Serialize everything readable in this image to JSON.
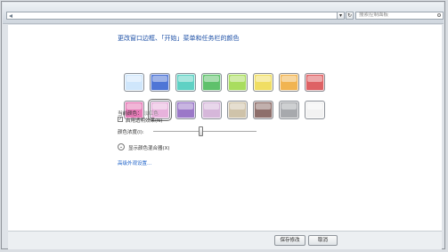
{
  "window": {
    "search": {
      "placeholder": "搜索控制面板"
    }
  },
  "toolbar": {
    "dropdown_icon": "chevron-down-icon",
    "refresh_icon": "refresh-icon"
  },
  "main": {
    "title": "更改窗口边框、「开始」菜单和任务栏的颜色",
    "swatches": [
      {
        "name": "sky",
        "color": "#cfe6fb"
      },
      {
        "name": "twilight",
        "color": "#4f76d6"
      },
      {
        "name": "sea",
        "color": "#5fd1c4"
      },
      {
        "name": "leaf",
        "color": "#5fc16c"
      },
      {
        "name": "lime",
        "color": "#a9dd5f"
      },
      {
        "name": "lemon",
        "color": "#f0de63"
      },
      {
        "name": "pumpkin",
        "color": "#f1b451"
      },
      {
        "name": "ruby",
        "color": "#de6265"
      },
      {
        "name": "fuchsia",
        "color": "#e67ab7"
      },
      {
        "name": "blush",
        "color": "#e7b2dc"
      },
      {
        "name": "violet",
        "color": "#9b78c8"
      },
      {
        "name": "lavender",
        "color": "#d6b7da"
      },
      {
        "name": "taupe",
        "color": "#cfc3aa"
      },
      {
        "name": "chocolate",
        "color": "#8e6f6b"
      },
      {
        "name": "slate",
        "color": "#a7a9ad"
      },
      {
        "name": "frost",
        "color": "#f2f2f2"
      }
    ],
    "selected_swatch_index": 9,
    "current_color_label": "当前颜色：",
    "current_color_value": "淡红色",
    "transparency_label": "启用透明效果(N)",
    "transparency_checked": true,
    "intensity_label": "颜色浓度(I):",
    "intensity_value_fraction": 0.5,
    "mixer_label": "显示颜色混合器(X)",
    "advanced_link": "高级外观设置..."
  },
  "footer": {
    "save_label": "保存修改",
    "cancel_label": "取消"
  }
}
